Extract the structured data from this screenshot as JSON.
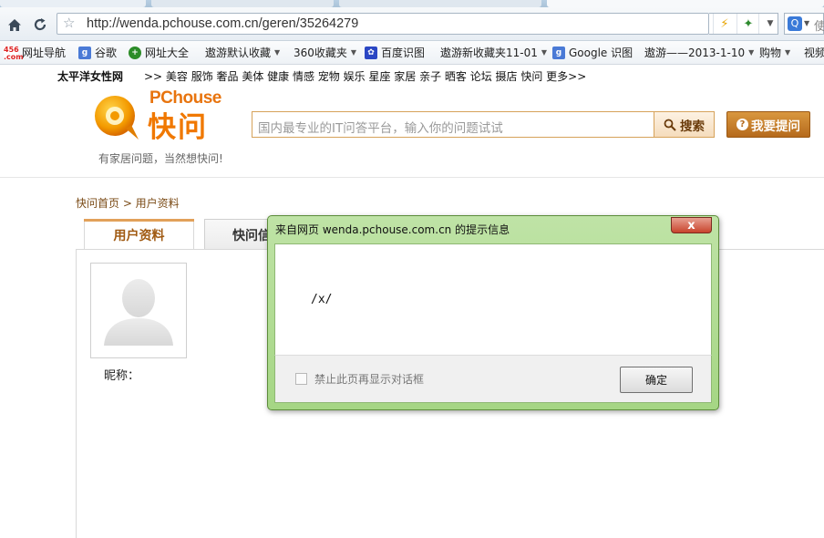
{
  "browser": {
    "url": "http://wenda.pchouse.com.cn/geren/35264279",
    "bookmarks": [
      {
        "label": "网址导航",
        "icon": "456-icon"
      },
      {
        "label": "谷歌",
        "icon": "google-icon"
      },
      {
        "label": "网址大全",
        "icon": "plus-icon"
      },
      {
        "label": "遨游默认收藏",
        "dropdown": true
      },
      {
        "label": "360收藏夹",
        "dropdown": true
      },
      {
        "label": "百度识图",
        "icon": "baidu-paw-icon"
      },
      {
        "label": "遨游新收藏夹11-01",
        "dropdown": true
      },
      {
        "label": "Google 识图",
        "icon": "google-icon"
      },
      {
        "label": "遨游——2013-1-10",
        "dropdown": true
      },
      {
        "label": "购物",
        "dropdown": true
      },
      {
        "label": "视频"
      }
    ],
    "search_partial": "使"
  },
  "site": {
    "network_brand": "太平洋女性网",
    "network_links": ">> 美容 服饰 奢品 美体 健康 情感 宠物 娱乐 星座 家居 亲子 晒客 论坛 摄店 快问 更多>>",
    "logo_brand": "PChouse",
    "logo_title": "快问",
    "slogan": "有家居问题，当然想快问!",
    "search_placeholder": "国内最专业的IT问答平台，输入你的问题试试",
    "search_button": "搜索",
    "ask_button": "我要提问",
    "breadcrumb": "快问首页 > 用户资料",
    "tabs": [
      "用户资料",
      "快问信"
    ],
    "nickname_label": "昵称："
  },
  "dialog": {
    "title": "来自网页 wenda.pchouse.com.cn 的提示信息",
    "close_symbol": "x",
    "message": "/x/",
    "checkbox_label": "禁止此页再显示对话框",
    "ok_label": "确定"
  }
}
